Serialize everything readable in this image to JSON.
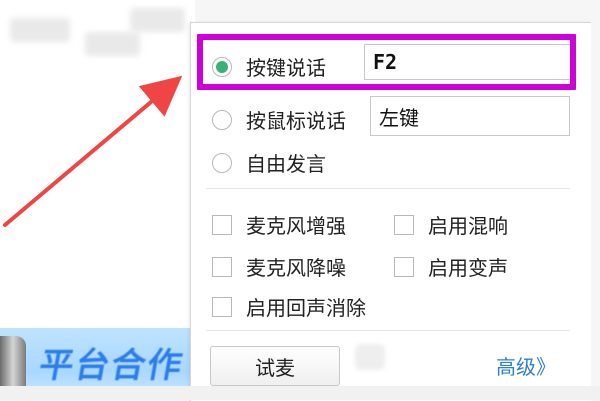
{
  "voice_settings": {
    "options": [
      {
        "label": "按键说话",
        "value": "F2",
        "selected": true
      },
      {
        "label": "按鼠标说话",
        "value": "左键",
        "selected": false
      },
      {
        "label": "自由发言",
        "selected": false
      }
    ],
    "checkboxes": [
      {
        "label": "麦克风增强",
        "checked": false
      },
      {
        "label": "启用混响",
        "checked": false
      },
      {
        "label": "麦克风降噪",
        "checked": false
      },
      {
        "label": "启用变声",
        "checked": false
      },
      {
        "label": "启用回声消除",
        "checked": false
      }
    ],
    "test_button_label": "试麦",
    "advanced_link_label": "高级》"
  },
  "colors": {
    "highlight": "#d000d8",
    "arrow": "#f04545",
    "selected_radio": "#39b27a",
    "link": "#2f7fd1"
  },
  "icons": {
    "annotation": "red-arrow-icon"
  }
}
